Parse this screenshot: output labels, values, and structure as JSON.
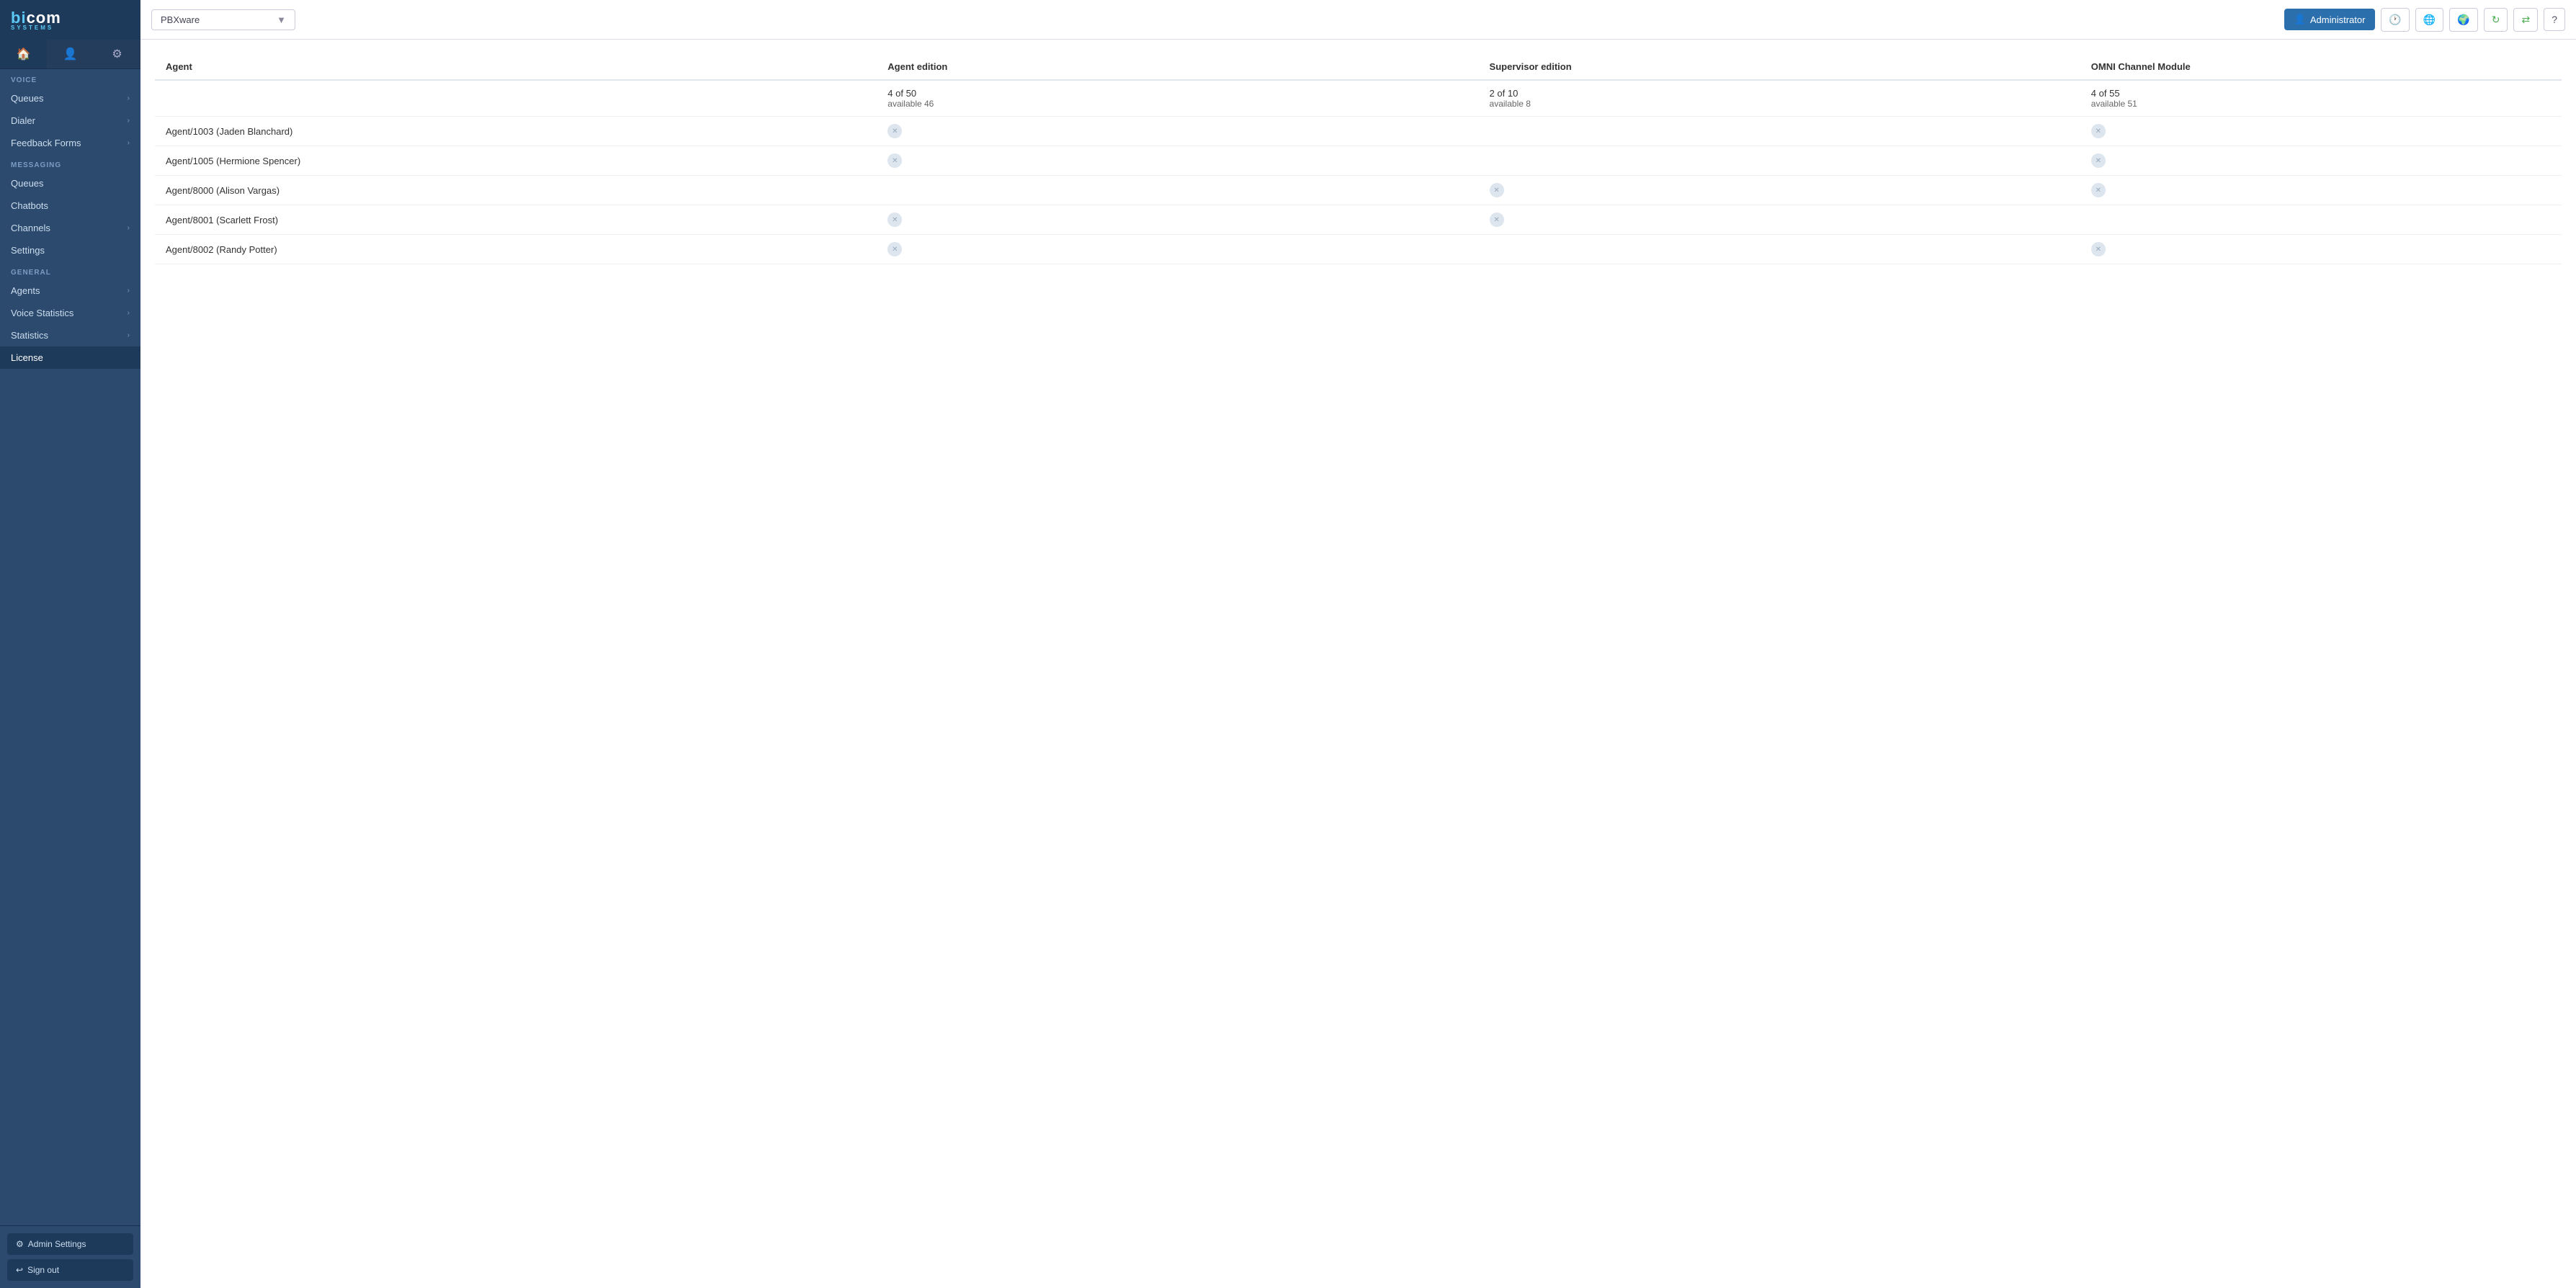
{
  "app": {
    "logo": "bicom",
    "logo_sub": "SYSTEMS"
  },
  "header": {
    "pbxware_label": "PBXware",
    "admin_label": "Administrator",
    "admin_icon": "👤"
  },
  "sidebar": {
    "sections": [
      {
        "label": "VOICE",
        "items": [
          {
            "id": "queues-voice",
            "label": "Queues",
            "has_arrow": true
          },
          {
            "id": "dialer",
            "label": "Dialer",
            "has_arrow": true
          },
          {
            "id": "feedback-forms",
            "label": "Feedback Forms",
            "has_arrow": true
          }
        ]
      },
      {
        "label": "MESSAGING",
        "items": [
          {
            "id": "queues-messaging",
            "label": "Queues",
            "has_arrow": false
          },
          {
            "id": "chatbots",
            "label": "Chatbots",
            "has_arrow": false
          },
          {
            "id": "channels",
            "label": "Channels",
            "has_arrow": true
          },
          {
            "id": "settings",
            "label": "Settings",
            "has_arrow": false
          }
        ]
      },
      {
        "label": "GENERAL",
        "items": [
          {
            "id": "agents",
            "label": "Agents",
            "has_arrow": true
          },
          {
            "id": "voice-statistics",
            "label": "Voice Statistics",
            "has_arrow": true
          },
          {
            "id": "statistics",
            "label": "Statistics",
            "has_arrow": true
          },
          {
            "id": "license",
            "label": "License",
            "has_arrow": false,
            "active": true
          }
        ]
      }
    ],
    "footer": {
      "admin_settings": "Admin Settings",
      "sign_out": "Sign out"
    }
  },
  "table": {
    "columns": [
      {
        "id": "agent",
        "label": "Agent"
      },
      {
        "id": "agent-edition",
        "label": "Agent edition"
      },
      {
        "id": "supervisor-edition",
        "label": "Supervisor edition"
      },
      {
        "id": "omni-channel",
        "label": "OMNI Channel Module"
      }
    ],
    "summary": {
      "agent_edition": {
        "used": "4 of 50",
        "available": "available 46"
      },
      "supervisor_edition": {
        "used": "2 of 10",
        "available": "available 8"
      },
      "omni_channel": {
        "used": "4 of 55",
        "available": "available 51"
      }
    },
    "rows": [
      {
        "agent": "Agent/1003 (Jaden Blanchard)",
        "has_agent_edition": true,
        "has_supervisor_edition": false,
        "has_omni_channel": true
      },
      {
        "agent": "Agent/1005 (Hermione Spencer)",
        "has_agent_edition": true,
        "has_supervisor_edition": false,
        "has_omni_channel": true
      },
      {
        "agent": "Agent/8000 (Alison Vargas)",
        "has_agent_edition": false,
        "has_supervisor_edition": true,
        "has_omni_channel": true
      },
      {
        "agent": "Agent/8001 (Scarlett Frost)",
        "has_agent_edition": true,
        "has_supervisor_edition": true,
        "has_omni_channel": false
      },
      {
        "agent": "Agent/8002 (Randy Potter)",
        "has_agent_edition": true,
        "has_supervisor_edition": false,
        "has_omni_channel": true
      }
    ]
  }
}
